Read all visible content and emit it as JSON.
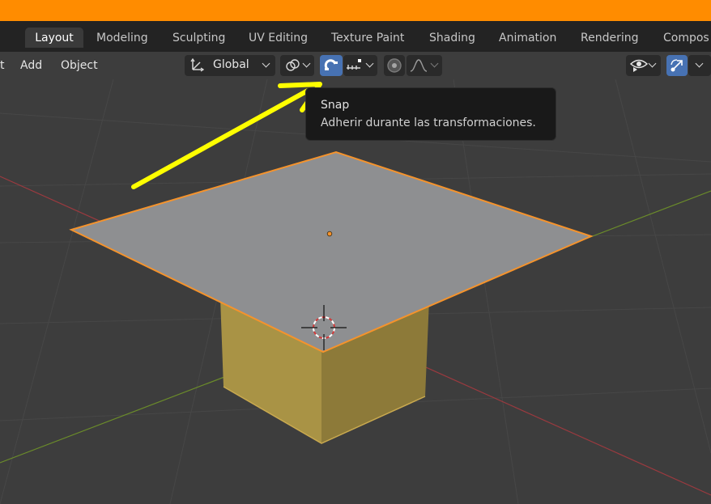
{
  "colors": {
    "top_bar": "#ff8c00",
    "workspace_bar": "#232323",
    "header_bar": "#3d3d3d",
    "viewport_bg": "#3d3d3d",
    "active_toggle": "#4772b3",
    "selection_outline": "#f5932c",
    "plane_fill": "#8e8f91",
    "cube_fill": "#a99345",
    "x_axis": "#9b3a3f",
    "y_axis": "#6b8c2a",
    "annotation_arrow": "#ffff00"
  },
  "workspaces": {
    "tabs": [
      {
        "label": "Layout",
        "active": true
      },
      {
        "label": "Modeling",
        "active": false
      },
      {
        "label": "Sculpting",
        "active": false
      },
      {
        "label": "UV Editing",
        "active": false
      },
      {
        "label": "Texture Paint",
        "active": false
      },
      {
        "label": "Shading",
        "active": false
      },
      {
        "label": "Animation",
        "active": false
      },
      {
        "label": "Rendering",
        "active": false
      },
      {
        "label": "Compos",
        "active": false
      }
    ]
  },
  "header": {
    "menu_partial": "t",
    "menu_add": "Add",
    "menu_object": "Object",
    "transform_orientation": "Global",
    "icons": {
      "orientation": "transform-orientation-icon",
      "pivot": "pivot-point-icon",
      "snap": "magnet-icon",
      "snap_target": "snap-increment-icon",
      "proportional": "proportional-editing-icon",
      "falloff": "falloff-curve-icon",
      "visibility": "eye-icon",
      "gizmo": "gizmo-icon"
    }
  },
  "tooltip": {
    "title": "Snap",
    "description": "Adherir durante las transformaciones."
  }
}
